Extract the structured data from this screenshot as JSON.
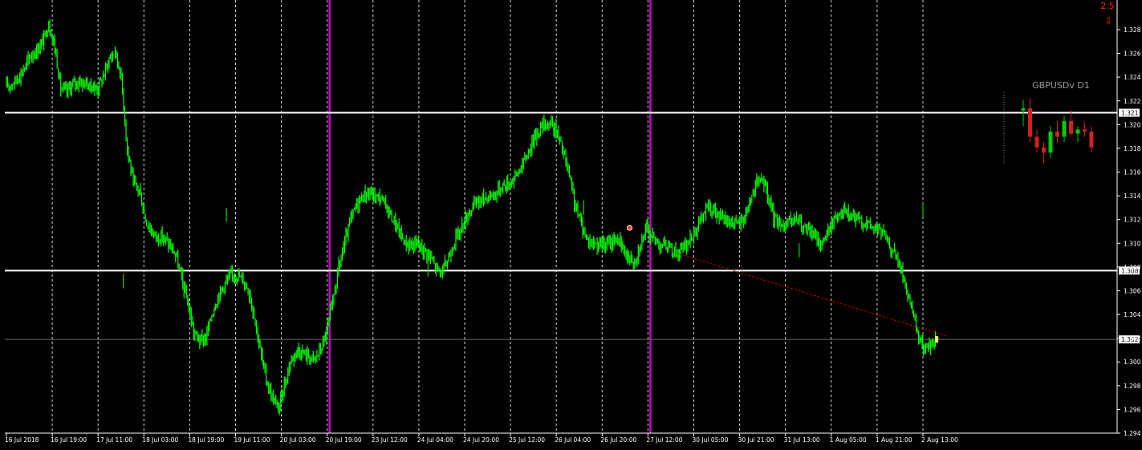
{
  "chart_data": {
    "type": "candlestick",
    "symbol_label": "GBPUSDv D1",
    "corner_value": "2.5",
    "colors": {
      "background": "#000000",
      "candle": "#00ff00",
      "grid": "#ffffff",
      "session_separator": "#cc00cc",
      "axis_text": "#ffffff",
      "mini_bull": "#00cc00",
      "mini_bear": "#cc2222",
      "indicator": "#ff0000",
      "trendline": "#cc0000"
    },
    "ylim": [
      1.294,
      1.3305
    ],
    "y_ticks": [
      "1.328",
      "1.326",
      "1.324",
      "1.322",
      "1.320",
      "1.318",
      "1.316",
      "1.314",
      "1.312",
      "1.310",
      "1.308",
      "1.306",
      "1.304",
      "1.302",
      "1.300",
      "1.298",
      "1.296",
      "1.294"
    ],
    "x_ticks": [
      "16 Jul 2018",
      "16 Jul 19:00",
      "17 Jul 11:00",
      "18 Jul 03:00",
      "18 Jul 19:00",
      "19 Jul 11:00",
      "20 Jul 03:00",
      "20 Jul 19:00",
      "23 Jul 12:00",
      "24 Jul 04:00",
      "24 Jul 20:00",
      "25 Jul 12:00",
      "26 Jul 04:00",
      "26 Jul 20:00",
      "27 Jul 12:00",
      "30 Jul 05:00",
      "30 Jul 21:00",
      "31 Jul 13:00",
      "1 Aug 05:00",
      "1 Aug 21:00",
      "2 Aug 13:00"
    ],
    "horizontal_lines": [
      {
        "label": "1.321",
        "value": 1.321,
        "style": "solid"
      },
      {
        "label": "1.308",
        "value": 1.3077,
        "style": "solid"
      },
      {
        "label": "1.302",
        "value": 1.3019,
        "style": "current"
      }
    ],
    "series_close": [
      1.3232,
      1.3235,
      1.324,
      1.3248,
      1.3258,
      1.3262,
      1.327,
      1.3285,
      1.3265,
      1.323,
      1.3228,
      1.3234,
      1.3236,
      1.3235,
      1.3232,
      1.323,
      1.324,
      1.3255,
      1.3262,
      1.324,
      1.318,
      1.315,
      1.3145,
      1.312,
      1.311,
      1.3105,
      1.3105,
      1.3098,
      1.309,
      1.307,
      1.305,
      1.3025,
      1.3018,
      1.302,
      1.304,
      1.3055,
      1.3065,
      1.3072,
      1.3074,
      1.307,
      1.3062,
      1.304,
      1.301,
      1.2985,
      1.297,
      1.296,
      1.298,
      1.3,
      1.301,
      1.3008,
      1.3005,
      1.3002,
      1.301,
      1.3025,
      1.305,
      1.308,
      1.31,
      1.312,
      1.3133,
      1.314,
      1.3142,
      1.314,
      1.3138,
      1.313,
      1.312,
      1.311,
      1.31,
      1.3098,
      1.31,
      1.3095,
      1.309,
      1.308,
      1.3075,
      1.3085,
      1.31,
      1.311,
      1.312,
      1.313,
      1.3135,
      1.3138,
      1.314,
      1.3142,
      1.3148,
      1.315,
      1.3155,
      1.3162,
      1.3172,
      1.3185,
      1.3195,
      1.32,
      1.3202,
      1.3195,
      1.318,
      1.316,
      1.3135,
      1.3118,
      1.3105,
      1.31,
      1.31,
      1.3098,
      1.31,
      1.3105,
      1.3095,
      1.3088,
      1.3085,
      1.31,
      1.3112,
      1.3105,
      1.31,
      1.3098,
      1.3095,
      1.3092,
      1.3095,
      1.3102,
      1.311,
      1.312,
      1.313,
      1.3128,
      1.3122,
      1.312,
      1.3118,
      1.3115,
      1.312,
      1.3135,
      1.3148,
      1.3155,
      1.314,
      1.3122,
      1.3118,
      1.3115,
      1.3118,
      1.312,
      1.3112,
      1.311,
      1.3105,
      1.31,
      1.311,
      1.312,
      1.3128,
      1.3125,
      1.3122,
      1.312,
      1.3118,
      1.3115,
      1.3112,
      1.311,
      1.31,
      1.3092,
      1.308,
      1.306,
      1.304,
      1.302,
      1.301,
      1.3015,
      1.302
    ],
    "mini_candles": [
      {
        "o": 1.321,
        "h": 1.322,
        "l": 1.3195,
        "c": 1.3212
      },
      {
        "o": 1.3212,
        "h": 1.3222,
        "l": 1.318,
        "c": 1.3185
      },
      {
        "o": 1.3185,
        "h": 1.3192,
        "l": 1.317,
        "c": 1.3175
      },
      {
        "o": 1.3175,
        "h": 1.318,
        "l": 1.316,
        "c": 1.317
      },
      {
        "o": 1.317,
        "h": 1.3195,
        "l": 1.3165,
        "c": 1.319
      },
      {
        "o": 1.319,
        "h": 1.32,
        "l": 1.318,
        "c": 1.3185
      },
      {
        "o": 1.3185,
        "h": 1.3205,
        "l": 1.318,
        "c": 1.32
      },
      {
        "o": 1.32,
        "h": 1.321,
        "l": 1.3185,
        "c": 1.3188
      },
      {
        "o": 1.3188,
        "h": 1.3195,
        "l": 1.318,
        "c": 1.3192
      },
      {
        "o": 1.3192,
        "h": 1.3198,
        "l": 1.3185,
        "c": 1.319
      },
      {
        "o": 1.319,
        "h": 1.3195,
        "l": 1.317,
        "c": 1.3175
      }
    ],
    "separators_at_x_index": [
      7.0,
      14.0
    ],
    "indicator_point": {
      "x_index": 13.6,
      "value": 1.3113
    },
    "trendline": {
      "from": {
        "x_index": 14.6,
        "value": 1.3092
      },
      "to": {
        "x_index": 20.5,
        "value": 1.3022
      }
    }
  }
}
